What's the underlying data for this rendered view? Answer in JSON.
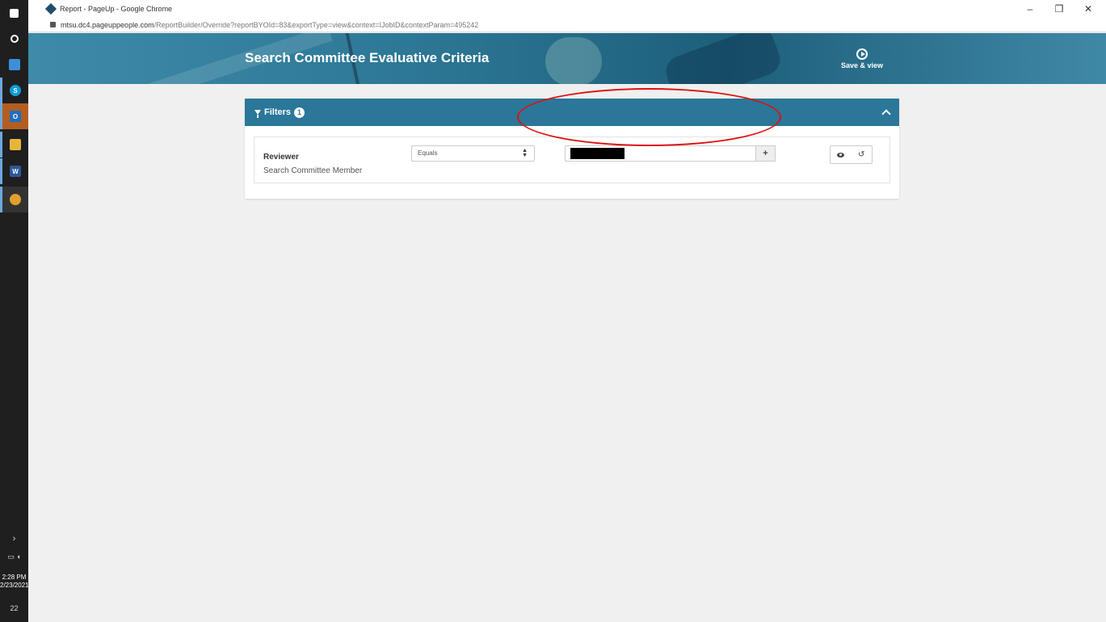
{
  "browser": {
    "window_title": "Report - PageUp - Google Chrome",
    "url_host": "mtsu.dc4.pageuppeople.com",
    "url_path": "/ReportBuilder/Override?reportBYOId=83&exportType=view&context=IJobID&contextParam=495242",
    "controls": {
      "minimize": "–",
      "restore": "❐",
      "close": "✕"
    }
  },
  "taskbar": {
    "clock_time": "2:28 PM",
    "clock_date": "2/23/2021",
    "notification_count": "22"
  },
  "banner": {
    "title": "Search Committee Evaluative Criteria",
    "save_view_label": "Save & view"
  },
  "filters": {
    "header_label": "Filters",
    "count_badge": "1",
    "rows": [
      {
        "field_label": "Reviewer",
        "field_sub_label": "Search Committee Member",
        "operator": "Equals",
        "add_label": "+"
      }
    ]
  },
  "colors": {
    "banner": "#2d7896",
    "panel_header": "#2a7799",
    "annotation": "#dd1111"
  }
}
